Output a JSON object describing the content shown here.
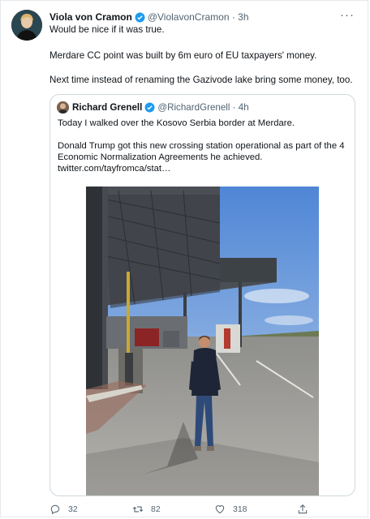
{
  "tweet": {
    "author_name": "Viola von Cramon",
    "handle": "@ViolavonCramon",
    "time": "3h",
    "lines": [
      "Would be nice if it was true.",
      "Merdare CC point was built by 6m euro of EU taxpayers' money.",
      "Next time instead of renaming the Gazivode lake bring some money, too."
    ]
  },
  "quoted": {
    "author_name": "Richard Grenell",
    "handle": "@RichardGrenell",
    "time": "4h",
    "lines": [
      "Today I walked over the Kosovo Serbia border at Merdare.",
      "Donald Trump got this new crossing station operational as part of the 4",
      "Economic Normalization Agreements he achieved.",
      "twitter.com/tayfromca/stat…"
    ]
  },
  "actions": {
    "replies": "32",
    "retweets": "82",
    "likes": "318"
  },
  "colors": {
    "verified": "#1d9bf0",
    "link": "#0f1419",
    "muted": "#536471"
  },
  "icons": [
    "more-icon",
    "verified-icon",
    "reply-icon",
    "retweet-icon",
    "like-icon",
    "share-icon"
  ]
}
